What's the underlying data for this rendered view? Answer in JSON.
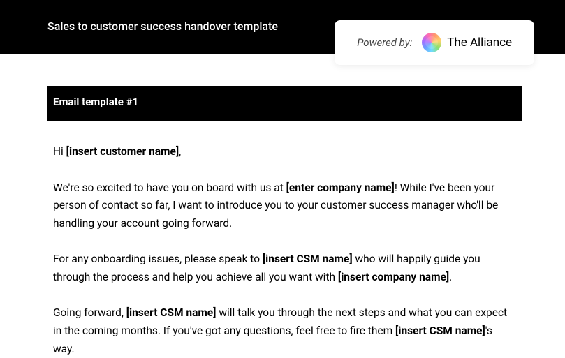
{
  "header": {
    "title": "Sales to customer success handover template"
  },
  "powered": {
    "label": "Powered by:",
    "brand": "The Alliance"
  },
  "section": {
    "title": "Email template #1"
  },
  "email": {
    "greeting_prefix": "Hi ",
    "greeting_placeholder": "[insert customer name]",
    "greeting_suffix": ",",
    "p1_a": "We're so excited to have you on board with us at ",
    "p1_b_placeholder": "[enter company name]",
    "p1_c": "! While I've been your person of contact so far, I want to introduce you to your customer success manager who'll be handling your account going forward.",
    "p2_a": "For any onboarding issues, please speak to ",
    "p2_b_placeholder": "[insert CSM name]",
    "p2_c": " who will happily guide you through the process and help you achieve all you want with ",
    "p2_d_placeholder": "[insert company name]",
    "p2_e": ".",
    "p3_a": "Going forward, ",
    "p3_b_placeholder": "[insert CSM name]",
    "p3_c": " will talk you through the next steps and what you can expect in the coming months. If you've got any questions, feel free to fire them ",
    "p3_d_placeholder": "[insert CSM name]",
    "p3_e": "'s way."
  }
}
